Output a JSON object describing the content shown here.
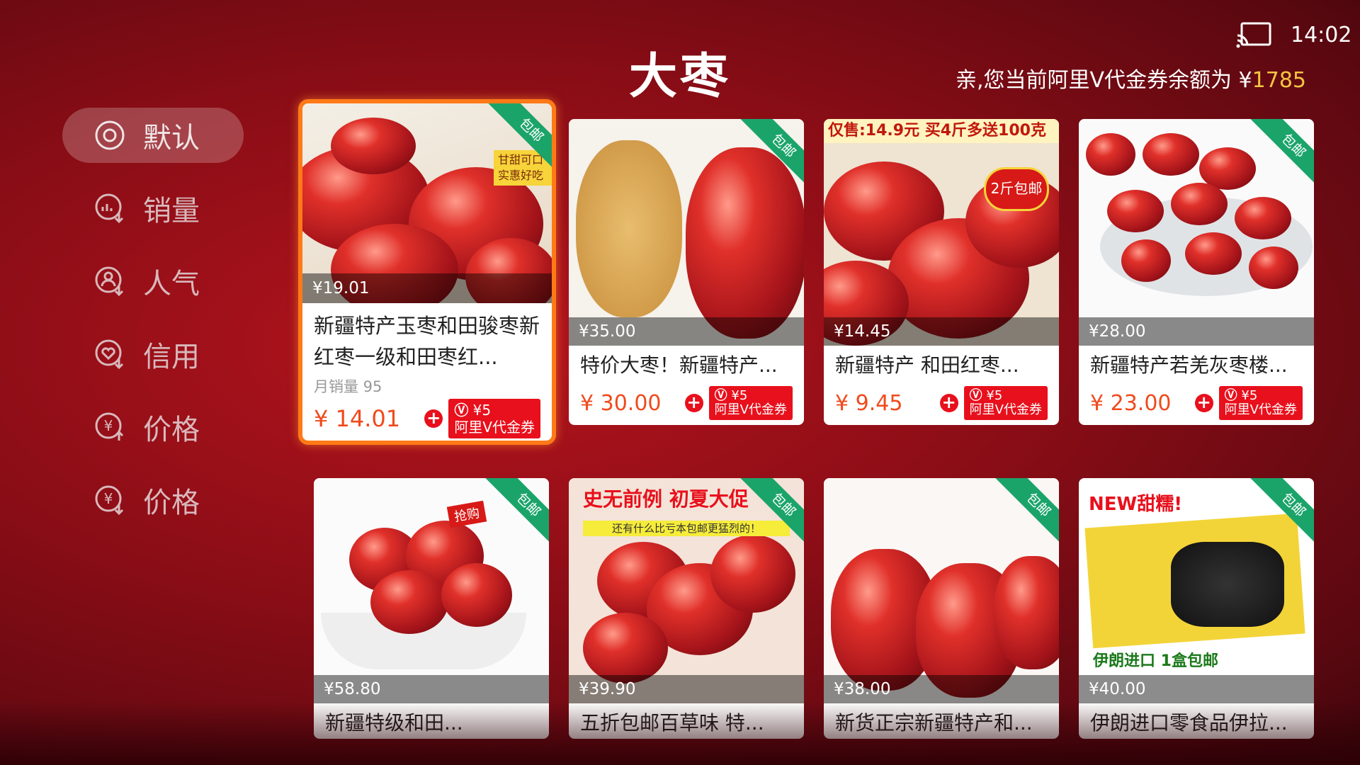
{
  "header": {
    "title": "大枣",
    "time": "14:02",
    "balance_label": "亲,您当前阿里V代金券余额为 ¥",
    "balance_amount": "1785"
  },
  "sidebar": {
    "items": [
      {
        "label": "默认",
        "icon": "radio-target-icon",
        "active": true
      },
      {
        "label": "销量",
        "icon": "sales-sort-icon",
        "active": false
      },
      {
        "label": "人气",
        "icon": "popularity-sort-icon",
        "active": false
      },
      {
        "label": "信用",
        "icon": "credit-sort-icon",
        "active": false
      },
      {
        "label": "价格",
        "icon": "price-sort-icon",
        "active": false
      },
      {
        "label": "价格",
        "icon": "price-sort-icon",
        "active": false
      }
    ]
  },
  "products": [
    {
      "original_price": "¥19.01",
      "title": "新疆特产玉枣和田骏枣新红枣一级和田枣红...",
      "sales": "月销量 95",
      "price": "¥ 14.01",
      "free_shipping": "包邮",
      "coupon_amount": "¥5",
      "coupon_text": "阿里V代金券",
      "banner": "甘甜可口 实惠好吃"
    },
    {
      "original_price": "¥35.00",
      "title": "特价大枣！新疆特产...",
      "price": "¥ 30.00",
      "free_shipping": "包邮",
      "coupon_amount": "¥5",
      "coupon_text": "阿里V代金券"
    },
    {
      "original_price": "¥14.45",
      "title": "新疆特产 和田红枣...",
      "price": "¥ 9.45",
      "coupon_amount": "¥5",
      "coupon_text": "阿里V代金券",
      "banner": "仅售:14.9元 买4斤多送100克",
      "badge": "2斤包邮"
    },
    {
      "original_price": "¥28.00",
      "title": "新疆特产若羌灰枣楼...",
      "price": "¥ 23.00",
      "free_shipping": "包邮",
      "coupon_amount": "¥5",
      "coupon_text": "阿里V代金券"
    },
    {
      "original_price": "¥58.80",
      "title": "新疆特级和田...",
      "free_shipping": "包邮",
      "badge": "抢购"
    },
    {
      "original_price": "¥39.90",
      "title": "五折包邮百草味 特...",
      "free_shipping": "包邮",
      "banner": "史无前例 初夏大促",
      "sub_banner": "还有什么比亏本包邮更猛烈的！"
    },
    {
      "original_price": "¥38.00",
      "title": "新货正宗新疆特产和...",
      "free_shipping": "包邮"
    },
    {
      "original_price": "¥40.00",
      "title": "伊朗进口零食品伊拉...",
      "free_shipping": "包邮",
      "banner": "NEW甜糯!",
      "sub_banner": "伊朗进口 1盒包邮"
    }
  ],
  "colors": {
    "accent_focus": "#ff7a17",
    "price_red": "#f04a1c",
    "coupon_red": "#e8101c",
    "free_ship_green": "#1ba46a",
    "balance_gold": "#f5c542"
  }
}
